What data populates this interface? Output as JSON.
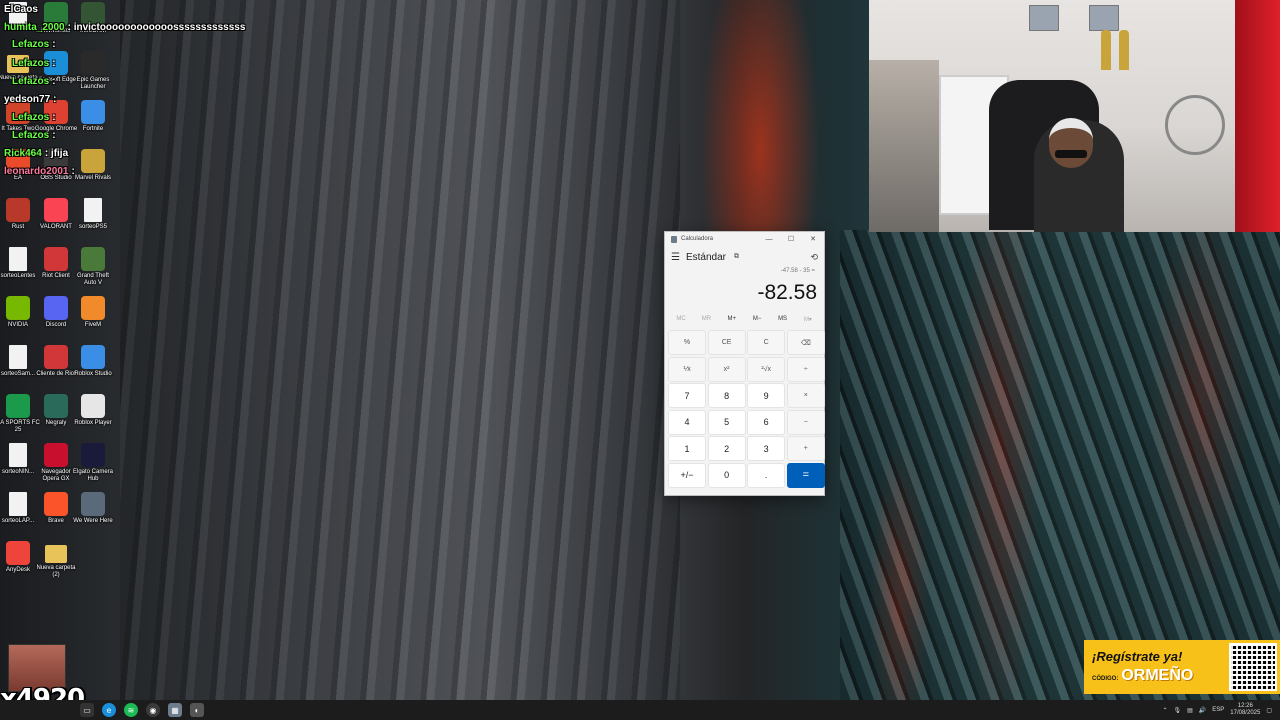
{
  "chat": [
    {
      "user": "ElCaos",
      "text": "",
      "style": ""
    },
    {
      "user": "humita_2000",
      "text": ": invictoooooooooooosssssssssssss",
      "style": "green"
    },
    {
      "user": "Lefazos",
      "text": ":",
      "style": "green"
    },
    {
      "user": "Lefazos",
      "text": ":",
      "style": "green"
    },
    {
      "user": "Lefazos",
      "text": ":",
      "style": "green"
    },
    {
      "user": "yedson77",
      "text": ":",
      "style": ""
    },
    {
      "user": "Lefazos",
      "text": ":",
      "style": "green"
    },
    {
      "user": "Lefazos",
      "text": ":",
      "style": "green"
    },
    {
      "user": "Rick464",
      "text": ": jfija",
      "style": "green"
    },
    {
      "user": "leonardo2001",
      "text": ":",
      "style": "pink"
    }
  ],
  "desktop_icons": [
    {
      "label": "",
      "kind": "doc",
      "color": "#f2f2f2"
    },
    {
      "label": "HWMonitor",
      "kind": "app",
      "color": "#2a7a3a"
    },
    {
      "label": "IntroORM",
      "kind": "app",
      "color": "#335533"
    },
    {
      "label": "Nueva carpeta",
      "kind": "folder",
      "color": "#e8c35a"
    },
    {
      "label": "Microsoft Edge",
      "kind": "app",
      "color": "#1a8fd8"
    },
    {
      "label": "Epic Games Launcher",
      "kind": "app",
      "color": "#2a2a2a"
    },
    {
      "label": "It Takes Two",
      "kind": "app",
      "color": "#d0452a"
    },
    {
      "label": "Google Chrome",
      "kind": "app",
      "color": "#de4032"
    },
    {
      "label": "Fortnite",
      "kind": "app",
      "color": "#3a8ee6"
    },
    {
      "label": "EA",
      "kind": "app",
      "color": "#e84a2a"
    },
    {
      "label": "OBS Studio",
      "kind": "app",
      "color": "#3a3a3a"
    },
    {
      "label": "Marvel Rivals",
      "kind": "app",
      "color": "#c9a43a"
    },
    {
      "label": "Rust",
      "kind": "app",
      "color": "#b8382a"
    },
    {
      "label": "VALORANT",
      "kind": "app",
      "color": "#fa4454"
    },
    {
      "label": "sorteoPS5",
      "kind": "doc",
      "color": "#f2f2f2"
    },
    {
      "label": "sorteoLentes",
      "kind": "doc",
      "color": "#f2f2f2"
    },
    {
      "label": "Riot Client",
      "kind": "app",
      "color": "#d13639"
    },
    {
      "label": "Grand Theft Auto V",
      "kind": "app",
      "color": "#4a7a3a"
    },
    {
      "label": "NVIDIA",
      "kind": "app",
      "color": "#76b900"
    },
    {
      "label": "Discord",
      "kind": "app",
      "color": "#5865f2"
    },
    {
      "label": "FiveM",
      "kind": "app",
      "color": "#f08a2a"
    },
    {
      "label": "sorteoSam...",
      "kind": "doc",
      "color": "#f2f2f2"
    },
    {
      "label": "Cliente de Riot",
      "kind": "app",
      "color": "#d13639"
    },
    {
      "label": "Roblox Studio",
      "kind": "app",
      "color": "#3a8ee6"
    },
    {
      "label": "EA SPORTS FC 25",
      "kind": "app",
      "color": "#1a9a4a"
    },
    {
      "label": "Negraly",
      "kind": "app",
      "color": "#2a6a5a"
    },
    {
      "label": "Roblox Player",
      "kind": "app",
      "color": "#e6e6e6"
    },
    {
      "label": "sorteoNIN...",
      "kind": "doc",
      "color": "#f2f2f2"
    },
    {
      "label": "Navegador Opera GX",
      "kind": "app",
      "color": "#c8102e"
    },
    {
      "label": "Elgato Camera Hub",
      "kind": "app",
      "color": "#1a1a3a"
    },
    {
      "label": "sorteoLAP...",
      "kind": "doc",
      "color": "#f2f2f2"
    },
    {
      "label": "Brave",
      "kind": "app",
      "color": "#fb542b"
    },
    {
      "label": "We Were Here",
      "kind": "app",
      "color": "#5a6a7a"
    },
    {
      "label": "AnyDesk",
      "kind": "app",
      "color": "#ef443b"
    },
    {
      "label": "Nueva carpeta (2)",
      "kind": "folder",
      "color": "#e8c35a"
    }
  ],
  "calculator": {
    "window_title": "Calculadora",
    "mode": "Estándar",
    "expression": "-47.58 - 35 =",
    "display": "-82.58",
    "memory": [
      {
        "label": "MC",
        "enabled": false
      },
      {
        "label": "MR",
        "enabled": false
      },
      {
        "label": "M+",
        "enabled": true
      },
      {
        "label": "M−",
        "enabled": true
      },
      {
        "label": "MS",
        "enabled": true
      },
      {
        "label": "M▾",
        "enabled": false
      }
    ],
    "keys": [
      {
        "label": "%",
        "type": "op",
        "name": "percent-key"
      },
      {
        "label": "CE",
        "type": "op",
        "name": "clear-entry-key"
      },
      {
        "label": "C",
        "type": "op",
        "name": "clear-key"
      },
      {
        "label": "⌫",
        "type": "op",
        "name": "backspace-key"
      },
      {
        "label": "⅟x",
        "type": "op",
        "name": "reciprocal-key"
      },
      {
        "label": "x²",
        "type": "op",
        "name": "square-key"
      },
      {
        "label": "²√x",
        "type": "op",
        "name": "sqrt-key"
      },
      {
        "label": "÷",
        "type": "op",
        "name": "divide-key"
      },
      {
        "label": "7",
        "type": "num",
        "name": "digit-7-key"
      },
      {
        "label": "8",
        "type": "num",
        "name": "digit-8-key"
      },
      {
        "label": "9",
        "type": "num",
        "name": "digit-9-key"
      },
      {
        "label": "×",
        "type": "op",
        "name": "multiply-key"
      },
      {
        "label": "4",
        "type": "num",
        "name": "digit-4-key"
      },
      {
        "label": "5",
        "type": "num",
        "name": "digit-5-key"
      },
      {
        "label": "6",
        "type": "num",
        "name": "digit-6-key"
      },
      {
        "label": "−",
        "type": "op",
        "name": "subtract-key"
      },
      {
        "label": "1",
        "type": "num",
        "name": "digit-1-key"
      },
      {
        "label": "2",
        "type": "num",
        "name": "digit-2-key"
      },
      {
        "label": "3",
        "type": "num",
        "name": "digit-3-key"
      },
      {
        "label": "+",
        "type": "op",
        "name": "add-key"
      },
      {
        "label": "+/−",
        "type": "num",
        "name": "negate-key"
      },
      {
        "label": "0",
        "type": "num",
        "name": "digit-0-key"
      },
      {
        "label": ".",
        "type": "num",
        "name": "decimal-key"
      },
      {
        "label": "=",
        "type": "eq",
        "name": "equals-key"
      }
    ]
  },
  "ad": {
    "headline": "¡Regístrate ya!",
    "code_label": "CÓDIGO:",
    "code": "ORMEÑO"
  },
  "counter": "x4920",
  "taskbar": {
    "language": "ESP",
    "time": "12:26",
    "date": "17/08/2025"
  },
  "colors": {
    "accent": "#005fb8",
    "ad_bg": "#f8c11a",
    "chat_green": "#6cff4a"
  }
}
